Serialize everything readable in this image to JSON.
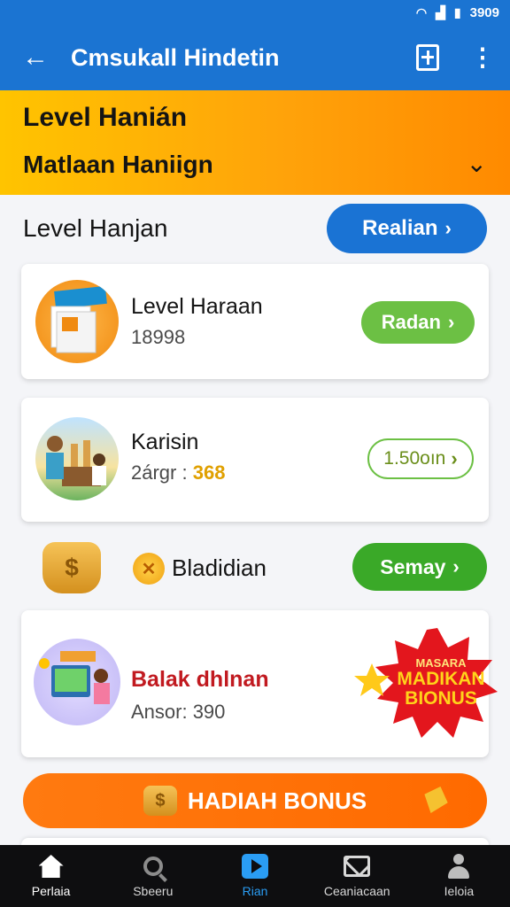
{
  "status_bar": {
    "time": "3909",
    "battery_icon": "battery-icon",
    "wifi_icon": "wifi-icon",
    "signal_icon": "signal-icon"
  },
  "app_bar": {
    "title": "Cmsukall Hindetin"
  },
  "banner": {
    "line1": "Level Hanián",
    "line2": "Matlaan Haniign"
  },
  "section": {
    "title": "Level Hanjan",
    "button_label": "Realian"
  },
  "cards": [
    {
      "title": "Level Haraan",
      "subtitle": "18998",
      "button_label": "Radan"
    },
    {
      "title": "Karisin",
      "subtitle_prefix": "2árgr :",
      "subtitle_value": "368",
      "button_label": "1.50oın"
    },
    {
      "title": "Balak dhlnan",
      "subtitle": "Ansor: 390",
      "badge_line1": "MASARA",
      "badge_line2": "MADIKAN",
      "badge_line3": "BIONUS"
    }
  ],
  "row": {
    "label": "Bladidian",
    "button_label": "Semay"
  },
  "bonus_button": {
    "label": "HADIAH BONUS"
  },
  "colors": {
    "primary": "#1b74d2",
    "accent_orange": "#ff7a10",
    "green": "#6cc044",
    "dark_green": "#3aa928"
  },
  "nav": {
    "items": [
      {
        "label": "Perlaia",
        "icon": "home-icon"
      },
      {
        "label": "Sbeeru",
        "icon": "search-icon"
      },
      {
        "label": "Rian",
        "icon": "play-icon"
      },
      {
        "label": "Ceaniacaan",
        "icon": "mail-icon"
      },
      {
        "label": "Ieloia",
        "icon": "user-icon"
      }
    ]
  }
}
